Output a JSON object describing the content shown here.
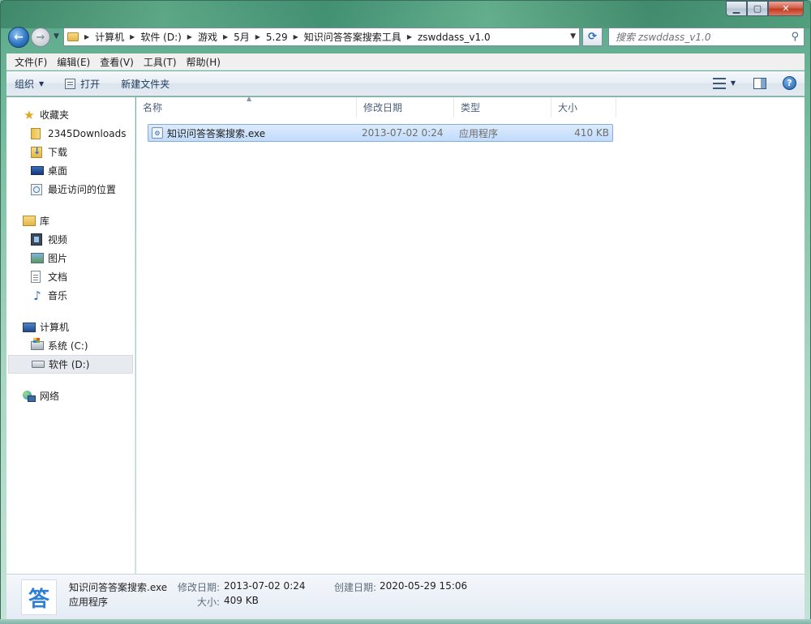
{
  "window": {
    "caption": {
      "min": "▁",
      "max": "▢",
      "close": "✕"
    }
  },
  "address": {
    "crumbs": [
      "计算机",
      "软件 (D:)",
      "游戏",
      "5月",
      "5.29",
      "知识问答答案搜索工具",
      "zswddass_v1.0"
    ]
  },
  "search": {
    "placeholder": "搜索 zswddass_v1.0"
  },
  "menu": [
    "文件(F)",
    "编辑(E)",
    "查看(V)",
    "工具(T)",
    "帮助(H)"
  ],
  "commands": {
    "organize": "组织",
    "open": "打开",
    "new_folder": "新建文件夹"
  },
  "nav": {
    "favorites": {
      "label": "收藏夹",
      "items": [
        "2345Downloads",
        "下载",
        "桌面",
        "最近访问的位置"
      ]
    },
    "libraries": {
      "label": "库",
      "items": [
        "视频",
        "图片",
        "文档",
        "音乐"
      ]
    },
    "computer": {
      "label": "计算机",
      "items": [
        "系统 (C:)",
        "软件 (D:)"
      ]
    },
    "network": {
      "label": "网络"
    }
  },
  "columns": {
    "name": "名称",
    "date": "修改日期",
    "type": "类型",
    "size": "大小"
  },
  "files": [
    {
      "name": "知识问答答案搜索.exe",
      "date": "2013-07-02 0:24",
      "type": "应用程序",
      "size": "410 KB"
    }
  ],
  "details": {
    "icon_char": "答",
    "filename": "知识问答答案搜索.exe",
    "filetype": "应用程序",
    "modified_label": "修改日期:",
    "modified_value": "2013-07-02 0:24",
    "size_label": "大小:",
    "size_value": "409 KB",
    "created_label": "创建日期:",
    "created_value": "2020-05-29 15:06"
  }
}
